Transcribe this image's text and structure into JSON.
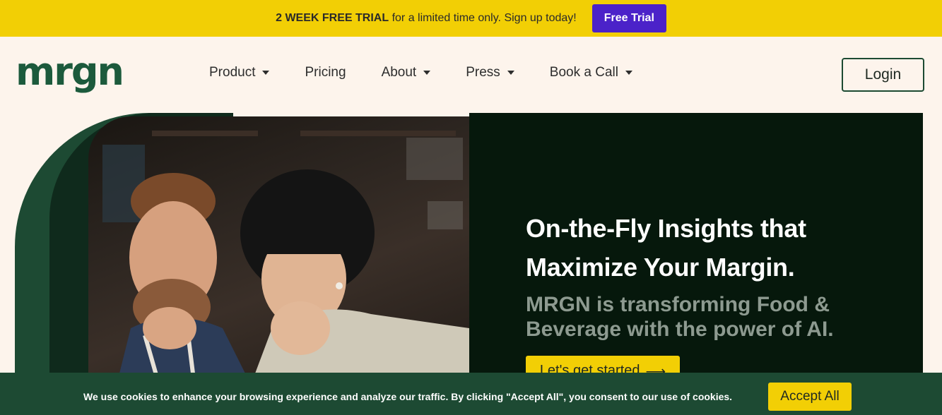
{
  "promo": {
    "bold": "2 WEEK FREE TRIAL",
    "text": " for a limited time only. Sign up today!",
    "button": "Free Trial"
  },
  "nav": {
    "logo": "mrgn",
    "items": [
      {
        "label": "Product",
        "dropdown": true
      },
      {
        "label": "Pricing",
        "dropdown": false
      },
      {
        "label": "About",
        "dropdown": true
      },
      {
        "label": "Press",
        "dropdown": true
      },
      {
        "label": "Book a Call",
        "dropdown": true
      }
    ],
    "login": "Login"
  },
  "hero": {
    "title_line1": "On-the-Fly Insights that",
    "title_line2": "Maximize Your Margin.",
    "subtitle": "MRGN is transforming Food & Beverage with the power of AI.",
    "cta": "Let's get started",
    "cta_icon": "arrow-right-icon",
    "photo_icon": "photo-two-people-looking-at-screen"
  },
  "cookie": {
    "text": "We use cookies to enhance your browsing experience and analyze our traffic.  By clicking \"Accept All\", you consent to our use of cookies.",
    "accept": "Accept All"
  },
  "colors": {
    "promo_bg": "#f2cf05",
    "promo_button": "#4b22c9",
    "page_bg": "#fdf4ec",
    "brand_green": "#1c5a3c",
    "hero_dark": "#06180c",
    "cookie_bg": "#1d4a33",
    "accent_yellow": "#f2cf05"
  }
}
